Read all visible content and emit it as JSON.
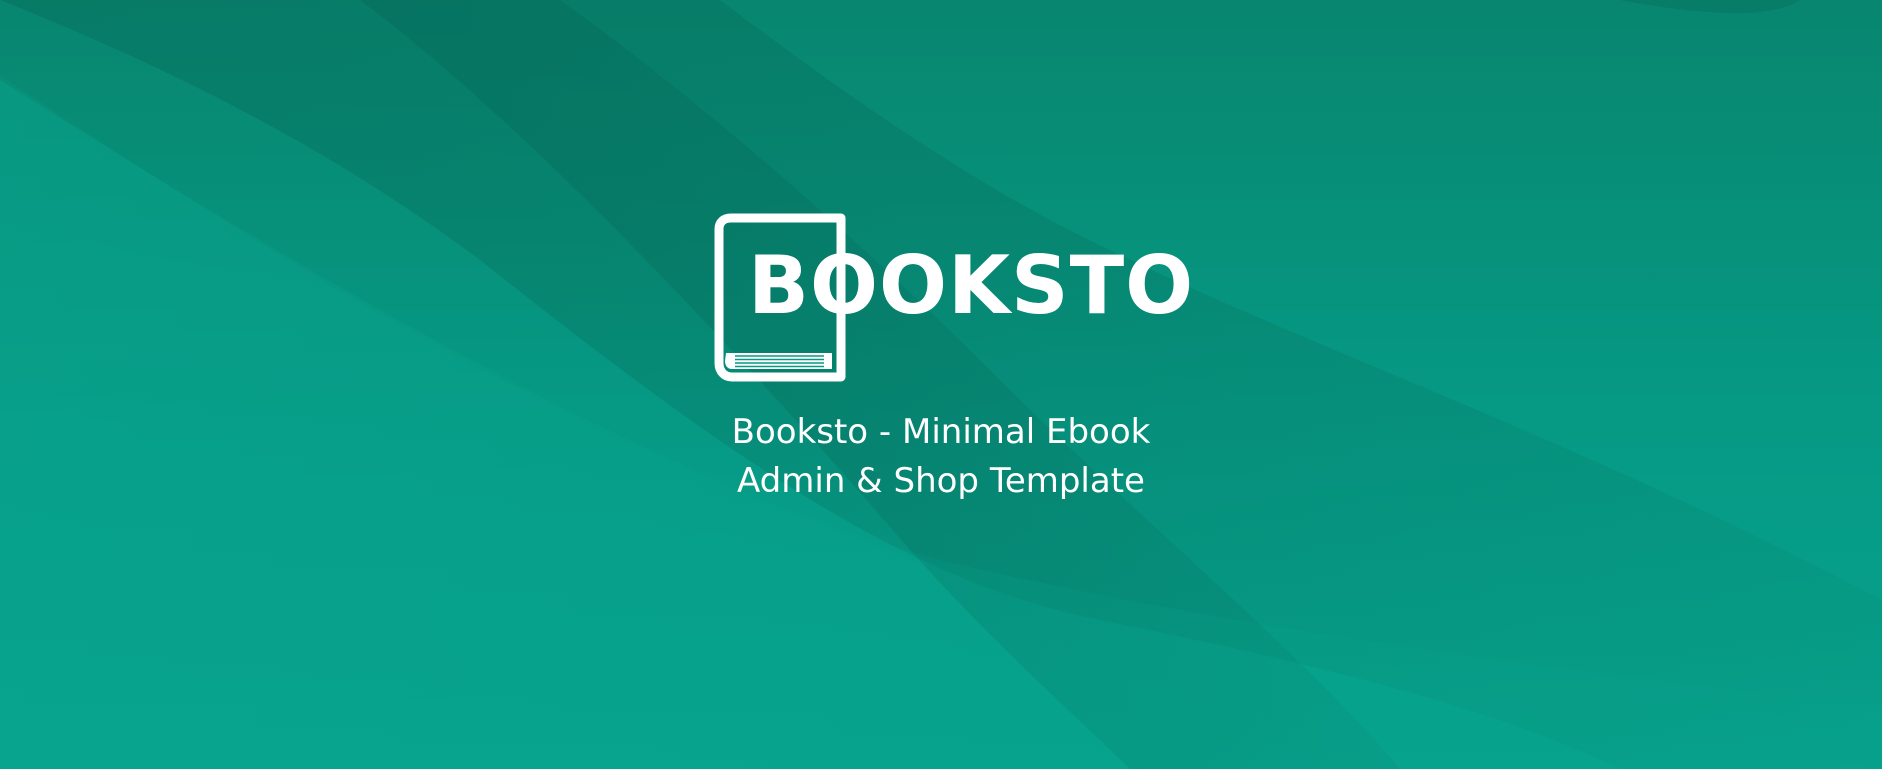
{
  "app": {
    "brand": "BOOKSTO",
    "tagline_line1": "Booksto - Minimal Ebook",
    "tagline_line2": "Admin & Shop Template"
  },
  "icons": {
    "book": "book-icon"
  },
  "colors": {
    "background_dark": "#08866f",
    "background_light": "#07a38d",
    "wave_shadow": "#06715f",
    "foreground": "#ffffff"
  }
}
